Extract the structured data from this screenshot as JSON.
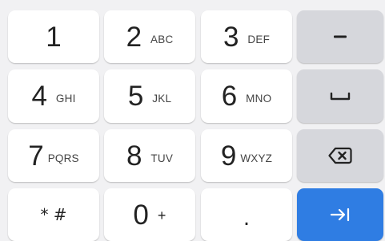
{
  "keys": {
    "k1": {
      "digit": "1",
      "letters": ""
    },
    "k2": {
      "digit": "2",
      "letters": "ABC"
    },
    "k3": {
      "digit": "3",
      "letters": "DEF"
    },
    "k4": {
      "digit": "4",
      "letters": "GHI"
    },
    "k5": {
      "digit": "5",
      "letters": "JKL"
    },
    "k6": {
      "digit": "6",
      "letters": "MNO"
    },
    "k7": {
      "digit": "7",
      "letters": "PQRS"
    },
    "k8": {
      "digit": "8",
      "letters": "TUV"
    },
    "k9": {
      "digit": "9",
      "letters": "WXYZ"
    },
    "k0": {
      "digit": "0",
      "letters": "+"
    },
    "star_hash": {
      "label": "* #"
    },
    "period": {
      "label": "."
    }
  },
  "function_keys": {
    "minus": {
      "icon": "minus-icon"
    },
    "space": {
      "icon": "space-icon"
    },
    "backspace": {
      "icon": "backspace-icon"
    },
    "next": {
      "icon": "next-tab-icon"
    }
  },
  "colors": {
    "background": "#f1f1f3",
    "key_light": "#ffffff",
    "key_function": "#d6d7dc",
    "accent": "#2f7de3"
  }
}
